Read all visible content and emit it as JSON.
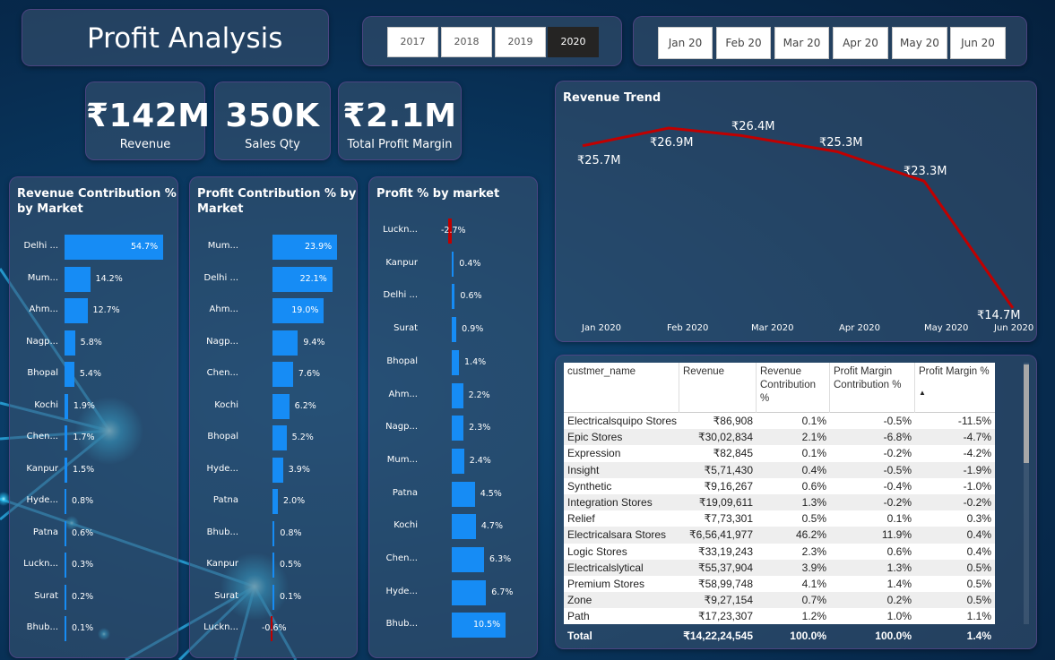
{
  "title": "Profit Analysis",
  "years": [
    {
      "label": "2017",
      "selected": false
    },
    {
      "label": "2018",
      "selected": false
    },
    {
      "label": "2019",
      "selected": false
    },
    {
      "label": "2020",
      "selected": true
    }
  ],
  "months": [
    "Jan 20",
    "Feb 20",
    "Mar 20",
    "Apr 20",
    "May 20",
    "Jun 20"
  ],
  "kpis": [
    {
      "value": "₹142M",
      "label": "Revenue"
    },
    {
      "value": "350K",
      "label": "Sales Qty"
    },
    {
      "value": "₹2.1M",
      "label": "Total Profit Margin"
    }
  ],
  "revenue_contribution": {
    "title_line1": "Revenue Contribution %",
    "title_line2": "by Market",
    "chart_data": {
      "type": "bar",
      "categories": [
        "Delhi ...",
        "Mum...",
        "Ahm...",
        "Nagp...",
        "Bhopal",
        "Kochi",
        "Chen...",
        "Kanpur",
        "Hyde...",
        "Patna",
        "Luckn...",
        "Surat",
        "Bhub..."
      ],
      "values": [
        54.7,
        14.2,
        12.7,
        5.8,
        5.4,
        1.9,
        1.7,
        1.5,
        0.8,
        0.6,
        0.3,
        0.2,
        0.1
      ],
      "labels": [
        "54.7%",
        "14.2%",
        "12.7%",
        "5.8%",
        "5.4%",
        "1.9%",
        "1.7%",
        "1.5%",
        "0.8%",
        "0.6%",
        "0.3%",
        "0.2%",
        "0.1%"
      ]
    }
  },
  "profit_contribution": {
    "title_line1": "Profit Contribution % by",
    "title_line2": "Market",
    "chart_data": {
      "type": "bar",
      "categories": [
        "Mum...",
        "Delhi ...",
        "Ahm...",
        "Nagp...",
        "Chen...",
        "Kochi",
        "Bhopal",
        "Hyde...",
        "Patna",
        "Bhub...",
        "Kanpur",
        "Surat",
        "Luckn..."
      ],
      "values": [
        23.9,
        22.1,
        19.0,
        9.4,
        7.6,
        6.2,
        5.2,
        3.9,
        2.0,
        0.8,
        0.5,
        0.1,
        -0.6
      ],
      "labels": [
        "23.9%",
        "22.1%",
        "19.0%",
        "9.4%",
        "7.6%",
        "6.2%",
        "5.2%",
        "3.9%",
        "2.0%",
        "0.8%",
        "0.5%",
        "0.1%",
        "-0.6%"
      ]
    }
  },
  "profit_by_market": {
    "title_line1": "Profit % by market",
    "chart_data": {
      "type": "bar",
      "categories": [
        "Luckn...",
        "Kanpur",
        "Delhi ...",
        "Surat",
        "Bhopal",
        "Ahm...",
        "Nagp...",
        "Mum...",
        "Patna",
        "Kochi",
        "Chen...",
        "Hyde...",
        "Bhub..."
      ],
      "values": [
        -2.7,
        0.4,
        0.6,
        0.9,
        1.4,
        2.2,
        2.3,
        2.4,
        4.5,
        4.7,
        6.3,
        6.7,
        10.5
      ],
      "labels": [
        "-2.7%",
        "0.4%",
        "0.6%",
        "0.9%",
        "1.4%",
        "2.2%",
        "2.3%",
        "2.4%",
        "4.5%",
        "4.7%",
        "6.3%",
        "6.7%",
        "10.5%"
      ]
    }
  },
  "revenue_trend": {
    "title": "Revenue Trend",
    "chart_data": {
      "type": "line",
      "x": [
        "Jan 2020",
        "Feb 2020",
        "Mar 2020",
        "Apr 2020",
        "May 2020",
        "Jun 2020"
      ],
      "values": [
        25.7,
        26.9,
        26.4,
        25.3,
        23.3,
        14.7
      ],
      "labels": [
        "₹25.7M",
        "₹26.9M",
        "₹26.4M",
        "₹25.3M",
        "₹23.3M",
        "₹14.7M"
      ],
      "color": "#c00000"
    }
  },
  "table": {
    "headers": [
      "custmer_name",
      "Revenue",
      "Revenue Contribution %",
      "Profit Margin Contribution %",
      "Profit Margin %"
    ],
    "sort_indicator": "▲",
    "rows": [
      [
        "Electricalsquipo Stores",
        "₹86,908",
        "0.1%",
        "-0.5%",
        "-11.5%"
      ],
      [
        "Epic Stores",
        "₹30,02,834",
        "2.1%",
        "-6.8%",
        "-4.7%"
      ],
      [
        "Expression",
        "₹82,845",
        "0.1%",
        "-0.2%",
        "-4.2%"
      ],
      [
        "Insight",
        "₹5,71,430",
        "0.4%",
        "-0.5%",
        "-1.9%"
      ],
      [
        "Synthetic",
        "₹9,16,267",
        "0.6%",
        "-0.4%",
        "-1.0%"
      ],
      [
        "Integration Stores",
        "₹19,09,611",
        "1.3%",
        "-0.2%",
        "-0.2%"
      ],
      [
        "Relief",
        "₹7,73,301",
        "0.5%",
        "0.1%",
        "0.3%"
      ],
      [
        "Electricalsara Stores",
        "₹6,56,41,977",
        "46.2%",
        "11.9%",
        "0.4%"
      ],
      [
        "Logic Stores",
        "₹33,19,243",
        "2.3%",
        "0.6%",
        "0.4%"
      ],
      [
        "Electricalslytical",
        "₹55,37,904",
        "3.9%",
        "1.3%",
        "0.5%"
      ],
      [
        "Premium Stores",
        "₹58,99,748",
        "4.1%",
        "1.4%",
        "0.5%"
      ],
      [
        "Zone",
        "₹9,27,154",
        "0.7%",
        "0.2%",
        "0.5%"
      ],
      [
        "Path",
        "₹17,23,307",
        "1.2%",
        "1.0%",
        "1.1%"
      ]
    ],
    "total": [
      "Total",
      "₹14,22,24,545",
      "100.0%",
      "100.0%",
      "1.4%"
    ]
  },
  "colors": {
    "bar": "#168cf5",
    "negative": "#c00000",
    "line": "#c00000"
  }
}
